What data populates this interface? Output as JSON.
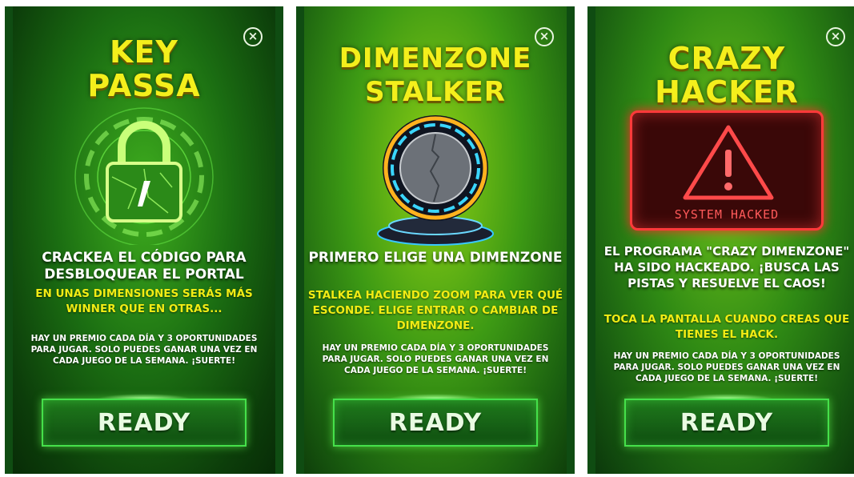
{
  "cards": [
    {
      "title_line1": "KEY",
      "title_line2": "PASSA",
      "close_glyph": "×",
      "headline": "CRACKEA EL CÓDIGO PARA DESBLOQUEAR EL PORTAL",
      "subtitle": "EN UNAS DIMENSIONES SERÁS MÁS WINNER QUE EN OTRAS...",
      "fine_print": "HAY UN PREMIO CADA DÍA Y 3 OPORTUNIDADES PARA JUGAR. SOLO PUEDES GANAR UNA VEZ EN CADA JUEGO DE LA SEMANA. ¡SUERTE!",
      "button_label": "READY",
      "illustration": "padlock-icon"
    },
    {
      "title_line1": "DIMENZONE",
      "title_line2": "STALKER",
      "close_glyph": "×",
      "headline": "PRIMERO ELIGE UNA DIMENZONE",
      "subtitle": "STALKEA HACIENDO ZOOM PARA VER QUÉ ESCONDE. ELIGE ENTRAR O CAMBIAR DE DIMENZONE.",
      "fine_print": "HAY UN PREMIO CADA DÍA Y 3 OPORTUNIDADES PARA JUGAR. SOLO PUEDES GANAR UNA VEZ EN CADA JUEGO DE LA SEMANA. ¡SUERTE!",
      "button_label": "READY",
      "illustration": "portal-icon"
    },
    {
      "title_line1": "CRAZY",
      "title_line2": "HACKER",
      "close_glyph": "×",
      "headline": "EL PROGRAMA \"CRAZY DIMENZONE\" HA SIDO HACKEADO. ¡BUSCA LAS PISTAS Y RESUELVE EL CAOS!",
      "subtitle": "TOCA LA PANTALLA CUANDO CREAS QUE TIENES EL HACK.",
      "fine_print": "HAY UN PREMIO CADA DÍA Y 3 OPORTUNIDADES PARA JUGAR. SOLO PUEDES GANAR UNA VEZ EN CADA JUEGO DE LA SEMANA. ¡SUERTE!",
      "button_label": "READY",
      "illustration": "warning-icon",
      "alert_text": "SYSTEM HACKED"
    }
  ],
  "colors": {
    "title_yellow": "#f4ef1c",
    "subtitle_yellow": "#f2ec14",
    "alert_red": "#ff2a2a",
    "button_border": "#45e04a"
  }
}
